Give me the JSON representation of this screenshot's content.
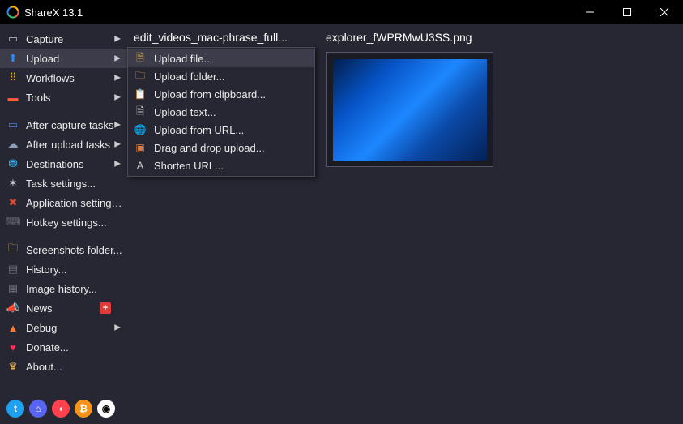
{
  "app": {
    "title": "ShareX 13.1"
  },
  "sidebar": {
    "items": [
      {
        "id": "capture",
        "label": "Capture",
        "arrow": true,
        "icon_color": "#b7c5d2",
        "glyph": "▭"
      },
      {
        "id": "upload",
        "label": "Upload",
        "arrow": true,
        "icon_color": "#2a8cff",
        "glyph": "⬆",
        "selected": true
      },
      {
        "id": "workflows",
        "label": "Workflows",
        "arrow": true,
        "icon_color": "#ffb400",
        "glyph": "⠿"
      },
      {
        "id": "tools",
        "label": "Tools",
        "arrow": true,
        "icon_color": "#ff5a3c",
        "glyph": "▬"
      }
    ],
    "items2": [
      {
        "id": "after-capture",
        "label": "After capture tasks",
        "arrow": true,
        "icon_color": "#4b7bd6",
        "glyph": "▭"
      },
      {
        "id": "after-upload",
        "label": "After upload tasks",
        "arrow": true,
        "icon_color": "#8aa0b8",
        "glyph": "☁"
      },
      {
        "id": "destinations",
        "label": "Destinations",
        "arrow": true,
        "icon_color": "#2fb8ff",
        "glyph": "⛃"
      },
      {
        "id": "task-settings",
        "label": "Task settings...",
        "icon_color": "#cfcfcf",
        "glyph": "✶"
      },
      {
        "id": "app-settings",
        "label": "Application settings...",
        "icon_color": "#d94b3a",
        "glyph": "✖"
      },
      {
        "id": "hotkey",
        "label": "Hotkey settings...",
        "icon_color": "#6f6f7a",
        "glyph": "⌨"
      }
    ],
    "items3": [
      {
        "id": "screenshots",
        "label": "Screenshots folder...",
        "icon_color": "#e8b24a",
        "glyph": "🗀"
      },
      {
        "id": "history",
        "label": "History...",
        "icon_color": "#6f6f7a",
        "glyph": "▤"
      },
      {
        "id": "imghistory",
        "label": "Image history...",
        "icon_color": "#6f6f7a",
        "glyph": "▦"
      },
      {
        "id": "news",
        "label": "News",
        "icon_color": "#ff4b4b",
        "glyph": "📣",
        "badge": "+"
      },
      {
        "id": "debug",
        "label": "Debug",
        "arrow": true,
        "icon_color": "#ff7a2d",
        "glyph": "▲"
      },
      {
        "id": "donate",
        "label": "Donate...",
        "icon_color": "#ff2d55",
        "glyph": "♥"
      },
      {
        "id": "about",
        "label": "About...",
        "icon_color": "#e8b24a",
        "glyph": "♛"
      }
    ]
  },
  "upload_menu": {
    "items": [
      {
        "id": "upload-file",
        "label": "Upload file...",
        "glyph": "🗎",
        "color": "#e8b24a",
        "hover": true
      },
      {
        "id": "upload-folder",
        "label": "Upload folder...",
        "glyph": "🗀",
        "color": "#e8b24a"
      },
      {
        "id": "upload-clip",
        "label": "Upload from clipboard...",
        "glyph": "📋",
        "color": "#b97a4a"
      },
      {
        "id": "upload-text",
        "label": "Upload text...",
        "glyph": "🗎",
        "color": "#cfcfcf"
      },
      {
        "id": "upload-url",
        "label": "Upload from URL...",
        "glyph": "🌐",
        "color": "#5aa0ff"
      },
      {
        "id": "upload-dnd",
        "label": "Drag and drop upload...",
        "glyph": "▣",
        "color": "#e07a3a"
      },
      {
        "id": "shorten-url",
        "label": "Shorten URL...",
        "glyph": "A",
        "color": "#cfcfcf"
      }
    ]
  },
  "thumbs": [
    {
      "id": "thumb1",
      "caption": "edit_videos_mac-phrase_full..."
    },
    {
      "id": "thumb2",
      "caption": "explorer_fWPRMwU3SS.png",
      "has_preview": true
    }
  ],
  "social": [
    {
      "id": "twitter",
      "bg": "#1da1f2",
      "glyph": "t"
    },
    {
      "id": "discord",
      "bg": "#5865f2",
      "glyph": "⌂"
    },
    {
      "id": "patreon",
      "bg": "#ff424d",
      "glyph": "◖"
    },
    {
      "id": "bitcoin",
      "bg": "#f7931a",
      "glyph": "₿"
    },
    {
      "id": "github",
      "bg": "#ffffff",
      "glyph": "◉",
      "fg": "#000"
    }
  ]
}
